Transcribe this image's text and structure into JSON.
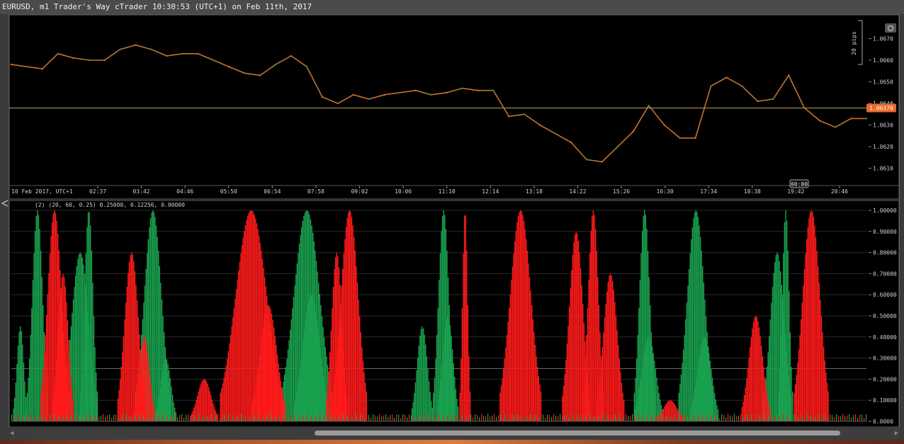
{
  "window": {
    "title": "EURUSD, m1 Trader's Way cTrader 10:30:53 (UTC+1) on Feb 11th, 2017"
  },
  "colors": {
    "background": "#000000",
    "price_line": "#e0e0e0",
    "candle_up": "#1fa24a",
    "candle_down": "#e06a2a",
    "level_line": "#b8a048",
    "badge": "#e8692b",
    "indicator_up": "#19a04e",
    "indicator_down": "#ff1a1a",
    "grid": "#2a2a2a"
  },
  "icons": {
    "camera": "camera-icon",
    "collapse": "triangle-left-icon"
  },
  "chart_data": [
    {
      "type": "line",
      "name": "price-panel",
      "title": "",
      "xlabel": "",
      "ylabel": "",
      "x_start_label": "10 Feb 2017, UTC+1",
      "x_ticks": [
        "02:37",
        "03:42",
        "04:46",
        "05:50",
        "06:54",
        "07:58",
        "09:02",
        "10:06",
        "11:10",
        "12:14",
        "13:18",
        "14:22",
        "15:26",
        "16:30",
        "17:34",
        "18:38",
        "19:42",
        "20:46"
      ],
      "y_ticks": [
        "1.0670",
        "1.0660",
        "1.0650",
        "1.0640",
        "1.0630",
        "1.0620",
        "1.0610"
      ],
      "ylim": [
        1.0603,
        1.0679
      ],
      "x": [
        "01:31",
        "01:50",
        "02:10",
        "02:37",
        "03:00",
        "03:20",
        "03:42",
        "04:00",
        "04:20",
        "04:46",
        "05:10",
        "05:30",
        "05:50",
        "06:10",
        "06:30",
        "06:54",
        "07:15",
        "07:40",
        "07:58",
        "08:20",
        "08:40",
        "09:02",
        "09:20",
        "09:40",
        "10:06",
        "10:30",
        "10:50",
        "11:10",
        "11:30",
        "11:50",
        "12:14",
        "12:40",
        "13:00",
        "13:18",
        "13:40",
        "14:00",
        "14:22",
        "14:40",
        "15:00",
        "15:26",
        "15:50",
        "16:10",
        "16:30",
        "16:50",
        "17:10",
        "17:34",
        "17:50",
        "18:10",
        "18:38",
        "19:00",
        "19:20",
        "19:42",
        "20:00",
        "20:20",
        "20:46",
        "21:05"
      ],
      "values": [
        1.0658,
        1.0657,
        1.0656,
        1.0663,
        1.0661,
        1.066,
        1.066,
        1.0665,
        1.0667,
        1.0665,
        1.0662,
        1.0663,
        1.0663,
        1.066,
        1.0657,
        1.0654,
        1.0653,
        1.0658,
        1.0662,
        1.0657,
        1.0643,
        1.064,
        1.0644,
        1.0642,
        1.0644,
        1.0645,
        1.0646,
        1.0644,
        1.0645,
        1.0647,
        1.0646,
        1.0646,
        1.0634,
        1.0635,
        1.063,
        1.0626,
        1.0622,
        1.0614,
        1.0613,
        1.062,
        1.0627,
        1.0639,
        1.063,
        1.0624,
        1.0624,
        1.0648,
        1.0652,
        1.0648,
        1.0641,
        1.0642,
        1.0653,
        1.0638,
        1.0632,
        1.0629,
        1.0633,
        1.0633
      ],
      "level_line": 1.06379,
      "level_label": "1.06379",
      "scale_label": "20 pips",
      "time_marker": "00:00",
      "grid": false
    },
    {
      "type": "bar",
      "name": "indicator-panel",
      "title": "(2) (20, 60, 0.25) 0.25000, 0.12256, 0.00000",
      "xlabel": "",
      "ylabel": "",
      "y_ticks": [
        "1.00000",
        "0.90000",
        "0.80000",
        "0.70000",
        "0.60000",
        "0.50000",
        "0.40000",
        "0.30000",
        "0.20000",
        "0.10000",
        "0.0000"
      ],
      "ylim": [
        0,
        1.0
      ],
      "threshold": 0.25,
      "grid": true,
      "series": [
        {
          "name": "up",
          "bursts": [
            {
              "t": 0.01,
              "peak": 0.45,
              "width": 0.004
            },
            {
              "t": 0.03,
              "peak": 1.0,
              "width": 0.006
            },
            {
              "t": 0.08,
              "peak": 0.8,
              "width": 0.01
            },
            {
              "t": 0.09,
              "peak": 1.0,
              "width": 0.005
            },
            {
              "t": 0.165,
              "peak": 1.0,
              "width": 0.01
            },
            {
              "t": 0.18,
              "peak": 0.3,
              "width": 0.006
            },
            {
              "t": 0.345,
              "peak": 1.0,
              "width": 0.015
            },
            {
              "t": 0.35,
              "peak": 0.6,
              "width": 0.01
            },
            {
              "t": 0.48,
              "peak": 0.45,
              "width": 0.006
            },
            {
              "t": 0.505,
              "peak": 1.0,
              "width": 0.006
            },
            {
              "t": 0.51,
              "peak": 0.5,
              "width": 0.006
            },
            {
              "t": 0.74,
              "peak": 1.0,
              "width": 0.006
            },
            {
              "t": 0.745,
              "peak": 0.4,
              "width": 0.008
            },
            {
              "t": 0.8,
              "peak": 1.0,
              "width": 0.01
            },
            {
              "t": 0.81,
              "peak": 0.4,
              "width": 0.008
            },
            {
              "t": 0.895,
              "peak": 0.8,
              "width": 0.008
            },
            {
              "t": 0.905,
              "peak": 1.0,
              "width": 0.004
            }
          ]
        },
        {
          "name": "down",
          "bursts": [
            {
              "t": 0.05,
              "peak": 1.0,
              "width": 0.008
            },
            {
              "t": 0.06,
              "peak": 0.7,
              "width": 0.006
            },
            {
              "t": 0.14,
              "peak": 0.8,
              "width": 0.008
            },
            {
              "t": 0.155,
              "peak": 0.4,
              "width": 0.006
            },
            {
              "t": 0.225,
              "peak": 0.2,
              "width": 0.008
            },
            {
              "t": 0.28,
              "peak": 1.0,
              "width": 0.018
            },
            {
              "t": 0.3,
              "peak": 0.55,
              "width": 0.01
            },
            {
              "t": 0.38,
              "peak": 0.8,
              "width": 0.006
            },
            {
              "t": 0.395,
              "peak": 1.0,
              "width": 0.01
            },
            {
              "t": 0.53,
              "peak": 1.0,
              "width": 0.003
            },
            {
              "t": 0.595,
              "peak": 1.0,
              "width": 0.012
            },
            {
              "t": 0.66,
              "peak": 0.9,
              "width": 0.008
            },
            {
              "t": 0.68,
              "peak": 1.0,
              "width": 0.006
            },
            {
              "t": 0.7,
              "peak": 0.7,
              "width": 0.008
            },
            {
              "t": 0.77,
              "peak": 0.1,
              "width": 0.008
            },
            {
              "t": 0.87,
              "peak": 0.5,
              "width": 0.008
            },
            {
              "t": 0.935,
              "peak": 1.0,
              "width": 0.01
            }
          ]
        }
      ]
    }
  ]
}
